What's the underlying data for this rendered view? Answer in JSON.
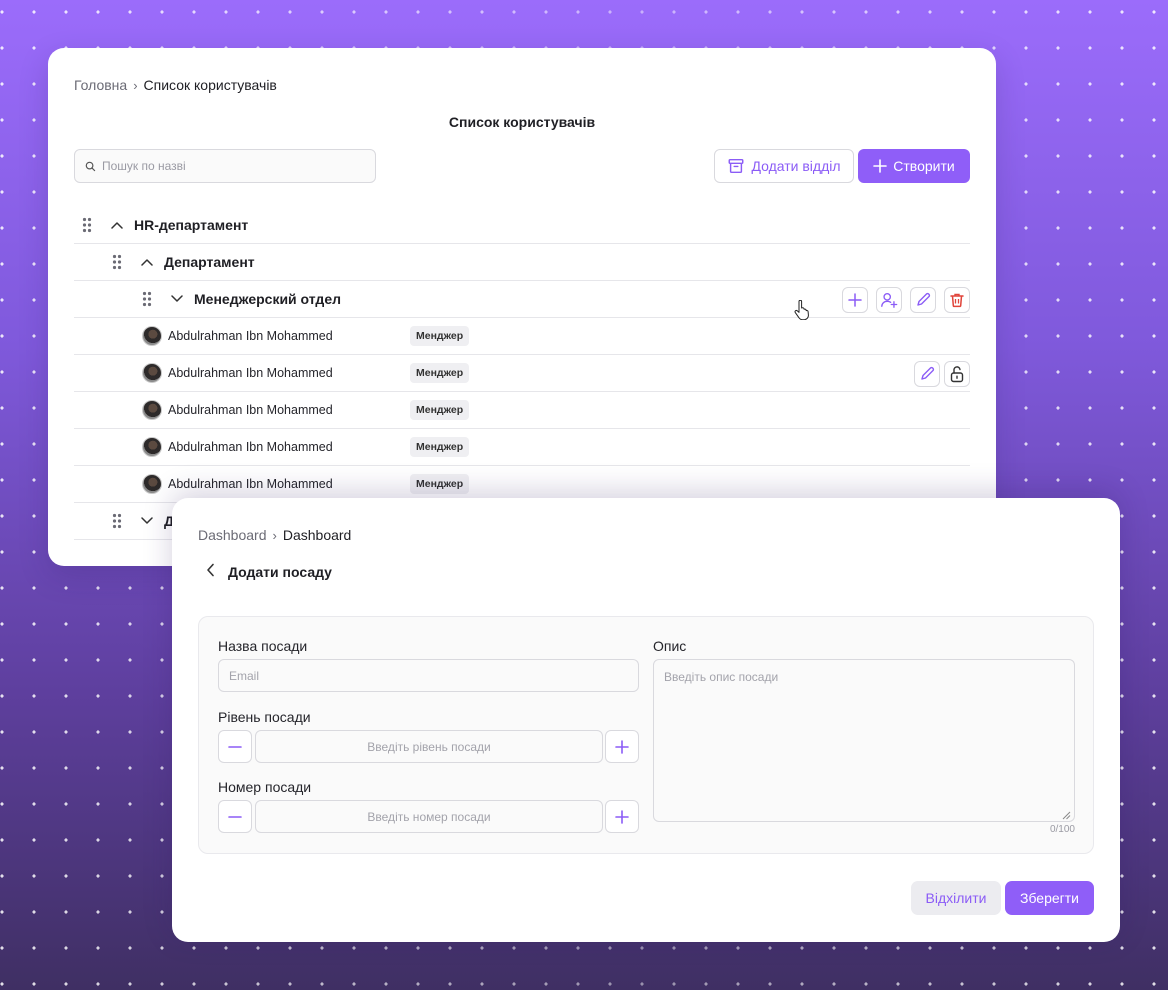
{
  "colors": {
    "accent": "#8f5ef8",
    "danger": "#e0443a",
    "background": "#7f59db"
  },
  "users_page": {
    "breadcrumb": {
      "home": "Головна",
      "current": "Список користувачів"
    },
    "title": "Список користувачів",
    "search": {
      "placeholder": "Пошук по назві",
      "value": ""
    },
    "add_department_label": "Додати відділ",
    "create_label": "Створити",
    "tree": {
      "hr_department": "HR-департамент",
      "department": "Департамент",
      "manager_dept": "Менеджерский отдел",
      "partial_row_label": "Д"
    },
    "users": [
      {
        "name": "Abdulrahman Ibn Mohammed",
        "role": "Менджер"
      },
      {
        "name": "Abdulrahman Ibn Mohammed",
        "role": "Менджер"
      },
      {
        "name": "Abdulrahman Ibn Mohammed",
        "role": "Менджер"
      },
      {
        "name": "Abdulrahman Ibn Mohammed",
        "role": "Менджер"
      },
      {
        "name": "Abdulrahman Ibn Mohammed",
        "role": "Менджер"
      }
    ]
  },
  "position_form": {
    "breadcrumb": {
      "root": "Dashboard",
      "current": "Dashboard"
    },
    "title": "Додати посаду",
    "name_label": "Назва посади",
    "name_placeholder": "Email",
    "level_label": "Рівень посади",
    "level_placeholder": "Введіть рівень посади",
    "number_label": "Номер посади",
    "number_placeholder": "Введіть номер посади",
    "description_label": "Опис",
    "description_placeholder": "Введіть опис посади",
    "counter": "0/100",
    "cancel_label": "Відхілити",
    "save_label": "Зберегти"
  }
}
